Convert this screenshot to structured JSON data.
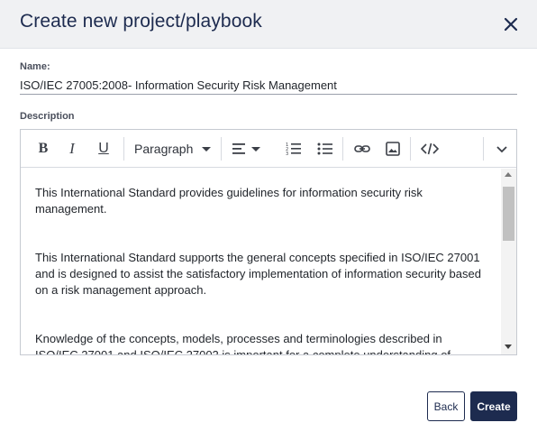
{
  "dialog": {
    "title": "Create new project/playbook",
    "close_icon": "close-icon"
  },
  "form": {
    "name_label": "Name:",
    "name_value": "ISO/IEC 27005:2008- Information Security Risk Management",
    "description_label": "Description"
  },
  "toolbar": {
    "bold": "B",
    "italic": "I",
    "underline": "U",
    "paragraph_label": "Paragraph",
    "icons": [
      "bold-icon",
      "italic-icon",
      "underline-icon",
      "paragraph-dropdown",
      "align-left-icon",
      "numbered-list-icon",
      "bulleted-list-icon",
      "link-icon",
      "image-icon",
      "code-icon",
      "chevron-down-icon"
    ]
  },
  "content": {
    "paragraphs": [
      "This International Standard provides guidelines for information security risk management.",
      "This International Standard supports the general concepts specified in ISO/IEC 27001 and is designed to assist the satisfactory implementation of information security based on a risk management approach.",
      "Knowledge of the concepts, models, processes and terminologies described in ISO/IEC 27001 and ISO/IEC 27002 is important for a complete understanding of"
    ]
  },
  "actions": {
    "back_label": "Back",
    "create_label": "Create"
  },
  "colors": {
    "primary": "#1d2b4f",
    "header_bg": "#f0f1f3"
  }
}
